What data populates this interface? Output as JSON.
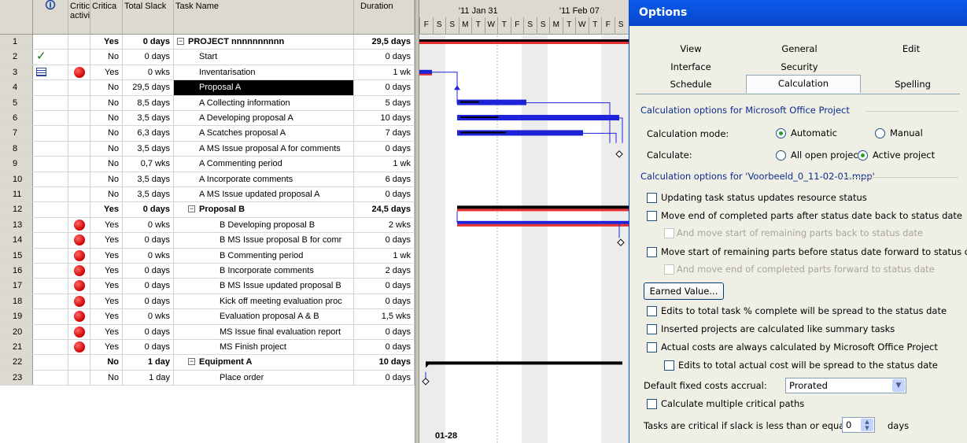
{
  "sheet": {
    "headers": {
      "indicators": "🛈",
      "crit1": "Critica activity",
      "crit2": "Critica",
      "slack": "Total Slack",
      "name": "Task Name",
      "duration": "Duration"
    },
    "rows": [
      {
        "id": "1",
        "crit": "Yes",
        "slack": "0 days",
        "name": "PROJECT nnnnnnnnnn",
        "dur": "29,5 days",
        "bold": true,
        "summary": true,
        "indent": 0
      },
      {
        "id": "2",
        "crit": "No",
        "slack": "0 days",
        "name": "Start",
        "dur": "0 days",
        "check": true,
        "indent": 1
      },
      {
        "id": "3",
        "crit": "Yes",
        "slack": "0 wks",
        "name": "Inventarisation",
        "dur": "1 wk",
        "dot": true,
        "gridicon": true,
        "indent": 1
      },
      {
        "id": "4",
        "crit": "No",
        "slack": "29,5 days",
        "name": "Proposal A",
        "dur": "0 days",
        "selected": true,
        "indent": 1
      },
      {
        "id": "5",
        "crit": "No",
        "slack": "8,5 days",
        "name": "A Collecting information",
        "dur": "5 days",
        "indent": 1
      },
      {
        "id": "6",
        "crit": "No",
        "slack": "3,5 days",
        "name": "A Developing proposal A",
        "dur": "10 days",
        "indent": 1
      },
      {
        "id": "7",
        "crit": "No",
        "slack": "6,3 days",
        "name": "A Scatches proposal A",
        "dur": "7 days",
        "indent": 1
      },
      {
        "id": "8",
        "crit": "No",
        "slack": "3,5 days",
        "name": "A MS Issue proposal A for comments",
        "dur": "0 days",
        "indent": 1
      },
      {
        "id": "9",
        "crit": "No",
        "slack": "0,7 wks",
        "name": "A Commenting period",
        "dur": "1 wk",
        "indent": 1
      },
      {
        "id": "10",
        "crit": "No",
        "slack": "3,5 days",
        "name": "A Incorporate comments",
        "dur": "6 days",
        "indent": 1
      },
      {
        "id": "11",
        "crit": "No",
        "slack": "3,5 days",
        "name": "A MS Issue updated proposal A",
        "dur": "0 days",
        "indent": 1
      },
      {
        "id": "12",
        "crit": "Yes",
        "slack": "0 days",
        "name": "Proposal B",
        "dur": "24,5 days",
        "bold": true,
        "summary": true,
        "indent": 1
      },
      {
        "id": "13",
        "crit": "Yes",
        "slack": "0 wks",
        "name": "B Developing proposal B",
        "dur": "2 wks",
        "dot": true,
        "indent": 2
      },
      {
        "id": "14",
        "crit": "Yes",
        "slack": "0 days",
        "name": "B MS Issue proposal B for comr",
        "dur": "0 days",
        "dot": true,
        "indent": 2
      },
      {
        "id": "15",
        "crit": "Yes",
        "slack": "0 wks",
        "name": "B Commenting period",
        "dur": "1 wk",
        "dot": true,
        "indent": 2
      },
      {
        "id": "16",
        "crit": "Yes",
        "slack": "0 days",
        "name": "B Incorporate comments",
        "dur": "2 days",
        "dot": true,
        "indent": 2
      },
      {
        "id": "17",
        "crit": "Yes",
        "slack": "0 days",
        "name": "B MS Issue updated proposal B",
        "dur": "0 days",
        "dot": true,
        "indent": 2
      },
      {
        "id": "18",
        "crit": "Yes",
        "slack": "0 days",
        "name": "Kick off meeting evaluation proc",
        "dur": "0 days",
        "dot": true,
        "indent": 2
      },
      {
        "id": "19",
        "crit": "Yes",
        "slack": "0 wks",
        "name": "Evaluation proposal A & B",
        "dur": "1,5 wks",
        "dot": true,
        "indent": 2
      },
      {
        "id": "20",
        "crit": "Yes",
        "slack": "0 days",
        "name": "MS Issue  final evaluation report",
        "dur": "0 days",
        "dot": true,
        "indent": 2
      },
      {
        "id": "21",
        "crit": "Yes",
        "slack": "0 days",
        "name": "MS Finish project",
        "dur": "0 days",
        "dot": true,
        "indent": 2
      },
      {
        "id": "22",
        "crit": "No",
        "slack": "1 day",
        "name": "Equipment A",
        "dur": "10 days",
        "bold": true,
        "summary": true,
        "indent": 1
      },
      {
        "id": "23",
        "crit": "No",
        "slack": "1 day",
        "name": "Place order",
        "dur": "0 days",
        "indent": 2
      }
    ]
  },
  "gantt": {
    "weeks": [
      "'11 Jan 31",
      "'11 Feb 07"
    ],
    "days": [
      "F",
      "S",
      "S",
      "M",
      "T",
      "W",
      "T",
      "F",
      "S",
      "S",
      "M",
      "T",
      "W",
      "T",
      "F",
      "S"
    ],
    "milestone_label": "01-28"
  },
  "options": {
    "title": "Options",
    "tabs_row1": [
      "View",
      "General",
      "Edit"
    ],
    "tabs_row2": [
      "Interface",
      "Security"
    ],
    "tabs_row3": [
      "Schedule",
      "Calculation",
      "Spelling"
    ],
    "sect1": "Calculation options for Microsoft Office Project",
    "calc_mode_label": "Calculation mode:",
    "automatic": "Automatic",
    "manual": "Manual",
    "calculate_label": "Calculate:",
    "all_open": "All open projects",
    "active": "Active project",
    "sect2": "Calculation options for 'Voorbeeld_0_11-02-01.mpp'",
    "opt_updating": "Updating task status updates resource status",
    "opt_move_end": "Move end of completed parts after status date back to status date",
    "opt_move_start_back": "And move start of remaining parts back to status date",
    "opt_move_start_fwd": "Move start of remaining parts before status date forward to status date",
    "opt_move_end_fwd": "And move end of completed parts forward to status date",
    "earned_value": "Earned Value...",
    "opt_edits_pct": "Edits to total task % complete will be spread to the status date",
    "opt_inserted": "Inserted projects are calculated like summary tasks",
    "opt_actual": "Actual costs are always calculated by Microsoft Office Project",
    "opt_edits_actual": "Edits to total actual cost will be spread to the status date",
    "fixed_label": "Default fixed costs accrual:",
    "fixed_value": "Prorated",
    "opt_multiple": "Calculate multiple critical paths",
    "slack_label": "Tasks are critical if slack is less than or equal to",
    "slack_value": "0",
    "slack_unit": "days"
  }
}
